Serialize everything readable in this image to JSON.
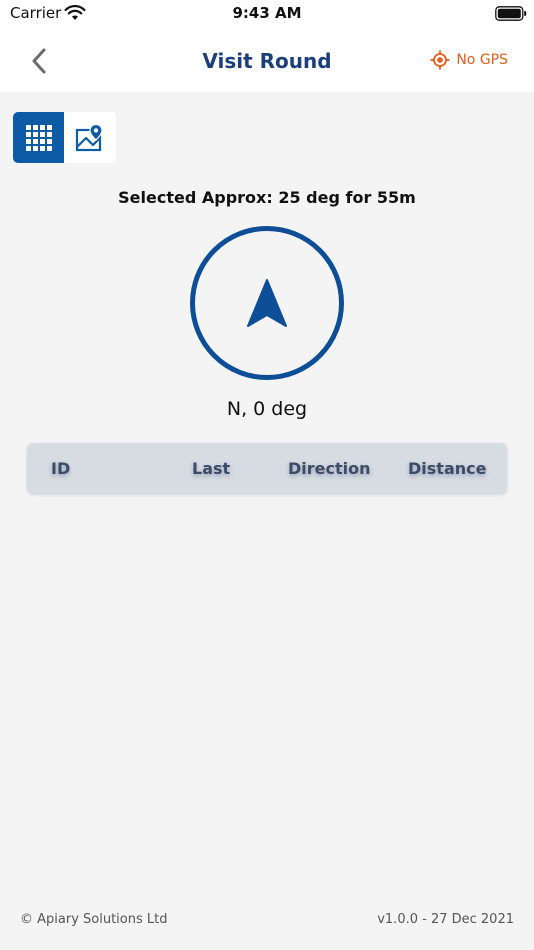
{
  "status_bar": {
    "carrier": "Carrier",
    "time": "9:43 AM"
  },
  "nav": {
    "title": "Visit Round",
    "gps_label": "No GPS",
    "gps_color": "#e25d1e",
    "title_color": "#1b3f7a"
  },
  "view_toggle": {
    "options": [
      {
        "name": "grid-view",
        "icon": "grid-icon",
        "selected": true
      },
      {
        "name": "map-view",
        "icon": "map-pin-icon",
        "selected": false
      }
    ],
    "active_color": "#0d5aa7"
  },
  "compass": {
    "selected_text": "Selected Approx: 25 deg for 55m",
    "heading_text": "N, 0 deg",
    "ring_color": "#0d4e96",
    "arrow_icon": "navigation-arrow-icon"
  },
  "table": {
    "columns": [
      "ID",
      "Last",
      "Direction",
      "Distance"
    ],
    "rows": []
  },
  "footer": {
    "copyright": "© Apiary Solutions Ltd",
    "version": "v1.0.0 - 27 Dec 2021"
  }
}
